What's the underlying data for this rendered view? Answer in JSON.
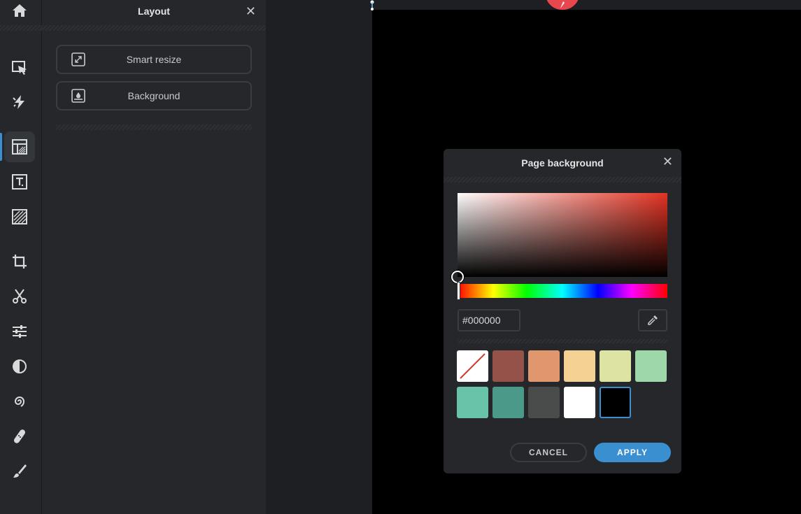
{
  "toolbar": {
    "items": [
      {
        "icon": "home-icon"
      },
      {
        "icon": "arrange-icon"
      },
      {
        "icon": "lightning-icon"
      },
      {
        "icon": "layout-icon",
        "active": true
      },
      {
        "icon": "text-icon"
      },
      {
        "icon": "texture-icon"
      },
      {
        "icon": "crop-icon"
      },
      {
        "icon": "cutout-icon"
      },
      {
        "icon": "adjust-icon"
      },
      {
        "icon": "contrast-icon"
      },
      {
        "icon": "spiral-icon"
      },
      {
        "icon": "heal-icon"
      },
      {
        "icon": "brush-icon"
      }
    ],
    "active_color": "#3a8fd1"
  },
  "panel": {
    "title": "Layout",
    "close": "✕",
    "buttons": [
      {
        "label": "Smart resize",
        "icon": "resize-icon"
      },
      {
        "label": "Background",
        "icon": "background-icon"
      }
    ]
  },
  "dialog": {
    "title": "Page background",
    "close": "✕",
    "hex_value": "#000000",
    "hue_color": "#e23222",
    "swatches": [
      "none",
      "#955248",
      "#e0976e",
      "#f4d294",
      "#dce3a3",
      "#9fd8a8",
      "#68c3a8",
      "#4b9989",
      "#4a4c4b",
      "#ffffff",
      "#000000"
    ],
    "selected_swatch": "#000000",
    "cancel_label": "CANCEL",
    "apply_label": "APPLY"
  }
}
